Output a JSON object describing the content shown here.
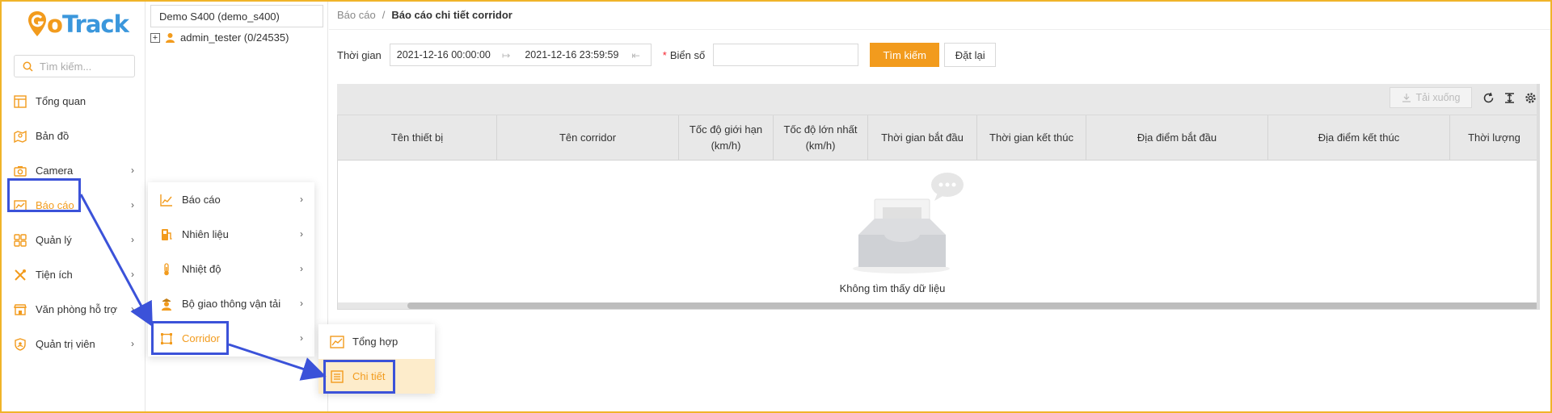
{
  "brand": {
    "logo_text_g": "G",
    "logo_text_o": "o",
    "logo_text_rest": "Track",
    "color_primary": "#f29b1d",
    "color_blue": "#3b97dc"
  },
  "sidebar": {
    "search_placeholder": "Tìm kiếm...",
    "items": [
      {
        "label": "Tổng quan",
        "icon": "dashboard-icon"
      },
      {
        "label": "Bản đồ",
        "icon": "map-icon"
      },
      {
        "label": "Camera",
        "icon": "camera-icon"
      },
      {
        "label": "Báo cáo",
        "icon": "chart-icon"
      },
      {
        "label": "Quản lý",
        "icon": "apps-icon"
      },
      {
        "label": "Tiện ích",
        "icon": "tools-icon"
      },
      {
        "label": "Văn phòng hỗ trợ",
        "icon": "store-icon"
      },
      {
        "label": "Quản trị viên",
        "icon": "shield-icon"
      }
    ]
  },
  "tree": {
    "selected": "Demo S400 (demo_s400)",
    "node": "admin_tester (0/24535)",
    "expand": "+"
  },
  "menu_report": {
    "items": [
      {
        "label": "Báo cáo",
        "icon": "line-chart-icon"
      },
      {
        "label": "Nhiên liệu",
        "icon": "fuel-icon"
      },
      {
        "label": "Nhiệt độ",
        "icon": "thermometer-icon"
      },
      {
        "label": "Bộ giao thông vận tải",
        "icon": "officer-icon"
      },
      {
        "label": "Corridor",
        "icon": "corridor-icon"
      }
    ]
  },
  "menu_corridor": {
    "items": [
      {
        "label": "Tổng hợp",
        "icon": "summary-chart-icon"
      },
      {
        "label": "Chi tiết",
        "icon": "list-detail-icon"
      }
    ]
  },
  "breadcrumb": {
    "parent": "Báo cáo",
    "separator": "/",
    "current": "Báo cáo chi tiết corridor"
  },
  "filter": {
    "time_label": "Thời gian",
    "start": "2021-12-16 00:00:00",
    "end": "2021-12-16 23:59:59",
    "plate_label": "Biển số",
    "required_mark": "*",
    "plate_value": "",
    "search_button": "Tìm kiếm",
    "reset_button": "Đặt lại"
  },
  "toolbar": {
    "download": "Tải xuống"
  },
  "table": {
    "columns": [
      "Tên thiết bị",
      "Tên corridor",
      "Tốc độ giới hạn (km/h)",
      "Tốc độ lớn nhất (km/h)",
      "Thời gian bắt đầu",
      "Thời gian kết thúc",
      "Địa điểm bắt đầu",
      "Địa điểm kết thúc",
      "Thời lượng"
    ],
    "rows": [],
    "empty_text": "Không tìm thấy dữ liệu"
  }
}
